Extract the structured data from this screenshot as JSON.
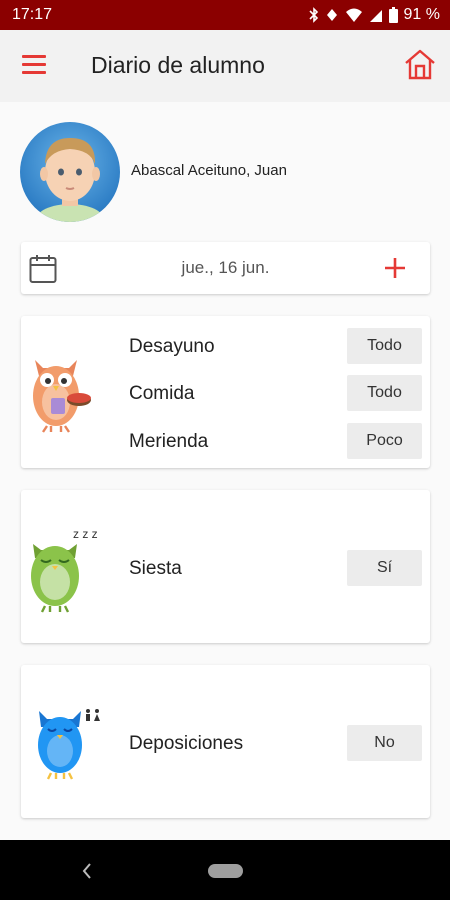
{
  "status_bar": {
    "time": "17:17",
    "battery": "91 %"
  },
  "app_bar": {
    "title": "Diario de alumno",
    "menu_icon": "hamburger-menu-icon",
    "home_icon": "home-icon"
  },
  "student": {
    "name": "Abascal Aceituno, Juan"
  },
  "date_bar": {
    "date": "jue., 16 jun.",
    "calendar_icon": "calendar-icon",
    "add_icon": "plus-icon"
  },
  "meals": {
    "rows": [
      {
        "label": "Desayuno",
        "value": "Todo"
      },
      {
        "label": "Comida",
        "value": "Todo"
      },
      {
        "label": "Merienda",
        "value": "Poco"
      }
    ]
  },
  "siesta": {
    "label": "Siesta",
    "value": "Sí",
    "zzz": "z z z"
  },
  "deposiciones": {
    "label": "Deposiciones",
    "value": "No"
  },
  "colors": {
    "status_bar": "#8b0000",
    "accent": "#e53935",
    "owl_orange": "#f29c6b",
    "owl_green": "#8bc34a",
    "owl_blue": "#2196f3"
  }
}
